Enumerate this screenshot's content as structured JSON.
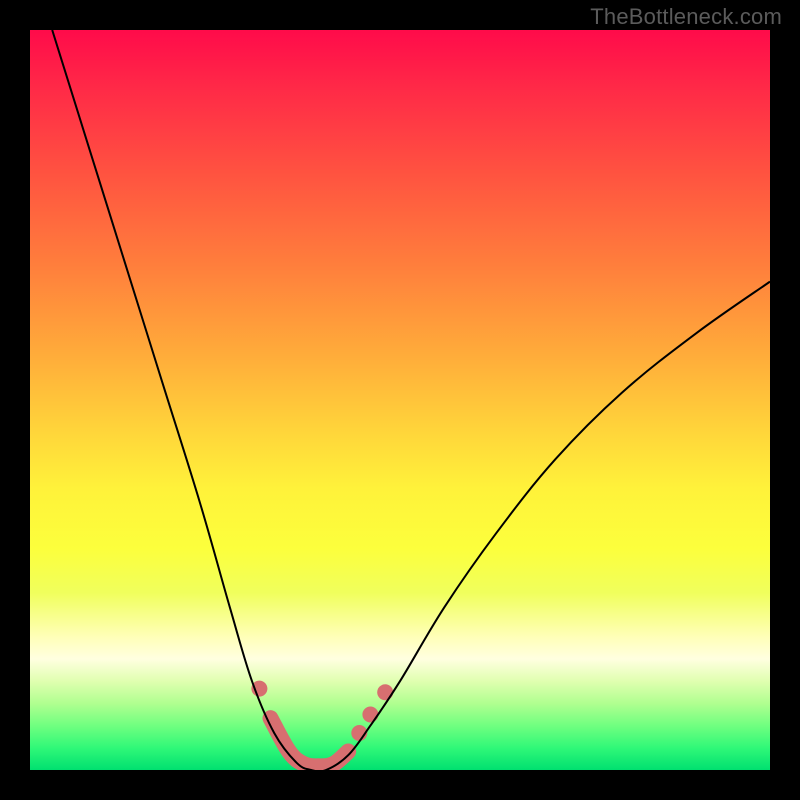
{
  "watermark": "TheBottleneck.com",
  "chart_data": {
    "type": "line",
    "title": "",
    "xlabel": "",
    "ylabel": "",
    "xlim": [
      0,
      100
    ],
    "ylim": [
      0,
      100
    ],
    "gradient_stops": [
      {
        "pct": 0,
        "color": "#ff0b4a"
      },
      {
        "pct": 8,
        "color": "#ff2a47"
      },
      {
        "pct": 20,
        "color": "#ff5540"
      },
      {
        "pct": 32,
        "color": "#ff7f3c"
      },
      {
        "pct": 45,
        "color": "#ffb03a"
      },
      {
        "pct": 55,
        "color": "#ffd83a"
      },
      {
        "pct": 62,
        "color": "#fff23a"
      },
      {
        "pct": 70,
        "color": "#fcff3c"
      },
      {
        "pct": 76,
        "color": "#f0ff5c"
      },
      {
        "pct": 82,
        "color": "#ffffb8"
      },
      {
        "pct": 85,
        "color": "#ffffe0"
      },
      {
        "pct": 88,
        "color": "#e0ffb0"
      },
      {
        "pct": 91,
        "color": "#b0ff90"
      },
      {
        "pct": 94,
        "color": "#70ff80"
      },
      {
        "pct": 97,
        "color": "#30f878"
      },
      {
        "pct": 100,
        "color": "#00e070"
      }
    ],
    "series": [
      {
        "name": "bottleneck-curve",
        "type": "line",
        "color": "#000000",
        "points": [
          {
            "x": 3,
            "y": 100
          },
          {
            "x": 8,
            "y": 84
          },
          {
            "x": 13,
            "y": 68
          },
          {
            "x": 18,
            "y": 52
          },
          {
            "x": 23,
            "y": 36
          },
          {
            "x": 27,
            "y": 22
          },
          {
            "x": 30,
            "y": 12
          },
          {
            "x": 33,
            "y": 5
          },
          {
            "x": 36,
            "y": 1
          },
          {
            "x": 38,
            "y": 0
          },
          {
            "x": 40,
            "y": 0
          },
          {
            "x": 43,
            "y": 2
          },
          {
            "x": 46,
            "y": 6
          },
          {
            "x": 50,
            "y": 12
          },
          {
            "x": 56,
            "y": 22
          },
          {
            "x": 63,
            "y": 32
          },
          {
            "x": 71,
            "y": 42
          },
          {
            "x": 80,
            "y": 51
          },
          {
            "x": 90,
            "y": 59
          },
          {
            "x": 100,
            "y": 66
          }
        ]
      },
      {
        "name": "highlight-segment",
        "type": "line",
        "color": "#d76f70",
        "stroke_width": 16,
        "points": [
          {
            "x": 32.5,
            "y": 7
          },
          {
            "x": 35,
            "y": 2.5
          },
          {
            "x": 37,
            "y": 0.8
          },
          {
            "x": 39,
            "y": 0.5
          },
          {
            "x": 41,
            "y": 0.8
          },
          {
            "x": 43,
            "y": 2.5
          }
        ]
      },
      {
        "name": "highlight-dots",
        "type": "scatter",
        "color": "#d76f70",
        "radius": 8,
        "points": [
          {
            "x": 31,
            "y": 11
          },
          {
            "x": 44.5,
            "y": 5
          },
          {
            "x": 46,
            "y": 7.5
          },
          {
            "x": 48,
            "y": 10.5
          }
        ]
      }
    ]
  }
}
